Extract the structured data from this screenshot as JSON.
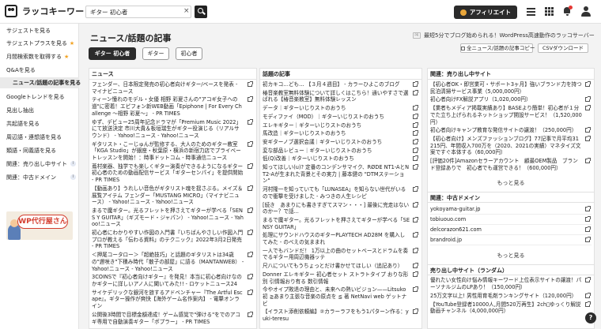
{
  "header": {
    "logo_text": "ラッコキーワード",
    "search_value": "ギター 初心者",
    "search_clear": "×",
    "affiliate_label": "アフィリエイト"
  },
  "sidebar": {
    "items": [
      {
        "label": "サジェストを見る"
      },
      {
        "label": "サジェストプラスを見る",
        "star": "★"
      },
      {
        "label": "月間検索数を取得する",
        "star": "★"
      },
      {
        "label": "Q&Aを見る"
      },
      {
        "label": "ニュース/話題の記事を見る"
      },
      {
        "label": "Googleトレンドを見る"
      },
      {
        "label": "見出し抽出"
      },
      {
        "label": "共起語を見る"
      },
      {
        "label": "周辺語・連想語を見る"
      },
      {
        "label": "類語・同義語を見る"
      },
      {
        "label": "関連：売り出し中サイト",
        "badge": "i"
      },
      {
        "label": "関連：中古ドメイン",
        "badge": "i"
      }
    ],
    "banner_text": "WP代行屋さん"
  },
  "main": {
    "title": "ニュース/話題の記事",
    "news_tag": "PR",
    "news_link": "最短5分でブログ始められる！WordPress高速動作のラッコサーバー",
    "chips": [
      "ギター 初心者",
      "ギター",
      "初心者"
    ],
    "copy_label": "全ニュース/話題の記事コピー",
    "csv_label": "CSVダウンロード"
  },
  "columns": {
    "news": {
      "title": "ニュース",
      "items": [
        "フェンダー、日本限定発売の初心者向けギター/ベースを発表 - マイナビニュース",
        "ティーン憧れのモデル・女優 相野 彩夏さんの\"アコギ女子への道\"に密着！エピフォン新WEB動画「Epiphone | For Every Challenge 〜相野 彩夏〜」 - PR TIMES",
        "ゆず、デビュー25周年記念ドラマが「Premium Music 2022」にて放送決定 市川大貴＆板垣瑞生がギター役演じる（リアルサウンド） - Yahoo!ニュース - Yahoo!ニュース",
        "ギタリスト・こーじゅんが監修する、大人のためのギター教室「KGA Studio」が銀座・秋葉原・横浜の新宿力店でプライベートレッスンを開始！：時事ドットコム - 時事通信ニュース",
        "蔦村楽器、独学でも楽しくギター演奏ができるようになるギター初心者のための動画配信サービス「ギターセンパイ」を提供開始 - PR TIMES",
        "【動画あり】うれしい音色がギタリスト魂を揺さぶる。メイズ＆展覧アイテム フェンダー「MUSTANG MICRO」（マイナビニュース） - Yahoo!ニュース - Yahoo!ニュース",
        "まるで魔ギター。光るフレットを押さえてギターが学べる「SENS Y GUITAR」（ギズモード・ジャパン） - Yahoo!ニュース - Yahoo!ニュース",
        "初心者にわかりやすい作図の入門書『いちばんやさしい作図入門 プロが教える「伝わる資料」のテクニック』2022年3月2日発売 - PR TIMES",
        "＜押尾コータロー＞「超絶技巧」と話題のギタリストは34歳の\"遅咲き\"下積み時代「散子の部屋」に語る（MANTANWEB） - Yahoo!ニュース - Yahoo!ニュース",
        "3COINSで『初心者向けギター』を発見！本当に初心者向けなのかギターに詳しいアノ人に聞いてみた!! - ロケットニュース24",
        "サイケデリックな銀河を旅するアドベンチャー『The Artful Escape』。ギター操作が爽快【海外ゲーム名作案内】 - 電撃オンライン",
        "公開後3時間で目標金額達成！ゲーム感覚で\"弾ける\"をでのアコギ専用で自動演奏ギター「ポプラー」 - PR TIMES"
      ]
    },
    "topics": {
      "title": "話題の記事",
      "items": [
        "初カキコ…ども… 【３月４週目】 - カラーひよこのブログ",
        "椿音楽教室無料体験について詳しくはこちら！通いやすさで選ばれる【椿音楽教室】無料体験レッスン",
        "データ｜ギターいじりストのおうち",
        "モディファイ（MOD）｜ギターいじりストのおうち",
        "エレキギター｜ギターいじりストのおうち",
        "馬改造｜ギターいじりストのおうち",
        "安ギターノブ選択会議｜ギターいじりストのおうち",
        "変な部品レビュー｜ギターいじりストのおうち",
        "低(Q)改善｜ギターいじりストのおうち",
        "知ってほしい(u)? 定番のコンデンサマイク、RØDE NT1-AとNT2-Aが生まれた背景とその実力 | 藤本健の \"DTMステーション\"",
        "河村隆一を知っていても「LUNASEA」を知らない世代がいるので衝撃を受けました - みつきの人生レシピ",
        "[続き　あまりにも書きすぎてスマン・・・] 最後に完走はないのかー？で話...",
        "まるで魔ギター。光るフレットを押さえてギターが学べる「SENSY GUITAR」",
        "処理にサウンドハウスのギターPLAYTECH AD28M を購入してみた - のべえの気ままれ",
        "一人でもバンドだ！ 1万以上の曲のセットベースとドラムを奏でるギター用周辺機器ッテ",
        "尺八についてもうちょっとだけ書かせてほしい（追記あり）",
        "Donner エレキギター 初心者セット ストラトタイプ おりな形別 引情報おり有る 数引情報",
        "今やオイプ敗退の理由と、未来への熱いビジョン——Litsuko初 ≧あまり主張な音楽の原点を ≦ 著 NetNavi web ゲットナビ",
        "【イラスト添削依頼編】②カラーラフをもう1パターン作る：yuki-teresu"
      ]
    },
    "sites": {
      "title": "関連：売り出し中サイト",
      "items": [
        "【初心者OK・即営業可・サポート3ヶ月】強いブランド力を持つ民泊清掃サービス事業（5,000,000円）",
        "初心者向けFX解説アプリ（1,020,000円）",
        "【業者もメディア掲載実績あり】BASEより簡単！初心者が１分でた立ち上げられるネットショップ開設サービス！（1,520,000円）",
        "初心者向けキャンプ教育な発信サイトの譲渡！（250,000円）",
        "【初心者向け】メンズファッションブログ】77記事で月平均31215円、年間収入700万を（2020、2021の実績）マネタイズ文案ですぐ本体する（60,000円）",
        "[評価20件]Amazonセラーアカウント　顧最OEM製品　ブランド登録ありで　初心者でも運営できる！（600,000円）"
      ],
      "more": "もっと見る"
    },
    "domains": {
      "title": "関連：中古ドメイン",
      "items": [
        "yokoyama-guitar.jp",
        "tobiuouo.com",
        "delcorazon621.com",
        "brandroid.jp"
      ],
      "more": "もっと見る"
    },
    "random": {
      "title": "売り出し中サイト（ランダム）",
      "items": [
        "優れたい女性向け悩み情報キーワード上位表示サイトの譲渡！パーソナルジムのLPあり！（150,000円）",
        "25万文字以上! 男性用育毛剤ランキングサイト（120,000円）",
        "【YouTube登録者10000人,月間520万再生】2ch゙ゆっくり解説動画チャンネル（4,000,000円）"
      ]
    }
  },
  "help_label": "?"
}
